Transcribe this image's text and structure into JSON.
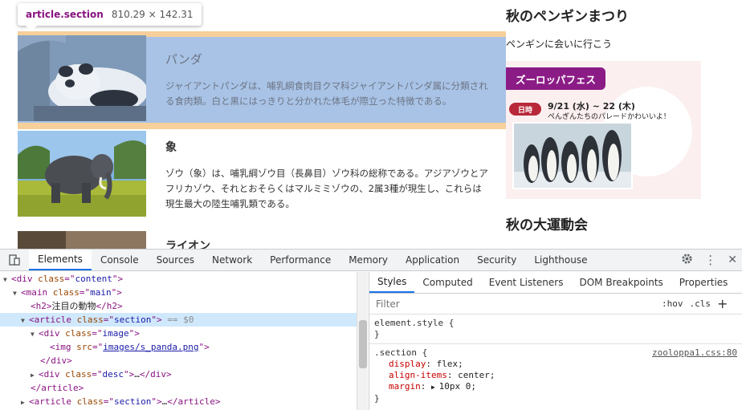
{
  "tooltip": {
    "element": "article.section",
    "size": "810.29 × 142.31"
  },
  "articles": [
    {
      "title": "パンダ",
      "text": "ジャイアントパンダは、哺乳綱食肉目クマ科ジャイアントパンダ属に分類される食肉類。白と黒にはっきりと分かれた体毛が際立った特徴である。"
    },
    {
      "title": "象",
      "text": "ゾウ（象）は、哺乳綱ゾウ目（長鼻目）ゾウ科の総称である。アジアゾウとアフリカゾウ、それとおそらくはマルミミゾウの、2属3種が現生し、これらは現生最大の陸生哺乳類である。"
    },
    {
      "title": "ライオン",
      "text": ""
    }
  ],
  "sidebar": {
    "title": "秋のペンギンまつり",
    "subtitle": "ペンギンに会いに行こう",
    "banner": {
      "pill": "ズーロッパフェス",
      "badge": "日時",
      "date": "9/21 (水) ~ 22 (木)",
      "caption": "ぺんぎんたちのパレードかわいいよ！"
    },
    "title2": "秋の大運動会"
  },
  "devtools": {
    "tabs": [
      "Elements",
      "Console",
      "Sources",
      "Network",
      "Performance",
      "Memory",
      "Application",
      "Security",
      "Lighthouse"
    ],
    "active_tab": "Elements",
    "styles_tabs": [
      "Styles",
      "Computed",
      "Event Listeners",
      "DOM Breakpoints",
      "Properties"
    ],
    "filter_placeholder": "Filter",
    "hov": ":hov",
    "cls": ".cls",
    "element_style": "element.style {",
    "close_brace": "}",
    "section_rule": {
      "selector": ".section {",
      "source": "zooloppa1.css:80",
      "decls": [
        {
          "prop": "display",
          "value": "flex;"
        },
        {
          "prop": "align-items",
          "value": "center;"
        },
        {
          "prop": "margin",
          "value": "10px 0;"
        }
      ]
    },
    "dom": {
      "l1_tag": "div",
      "l1_class": "content",
      "l2_tag": "main",
      "l2_class": "main",
      "l3_text": "注目の動物",
      "l4_class": "section",
      "l4_eq": "== $0",
      "l5_class": "image",
      "l6_src": "images/s_panda.png",
      "l8_class": "desc",
      "ellipsis": "…",
      "l11_class": "section"
    },
    "colors": {
      "accent": "#1a73e8",
      "tag": "#881280",
      "attr": "#994500",
      "value": "#1a1aa6"
    }
  }
}
